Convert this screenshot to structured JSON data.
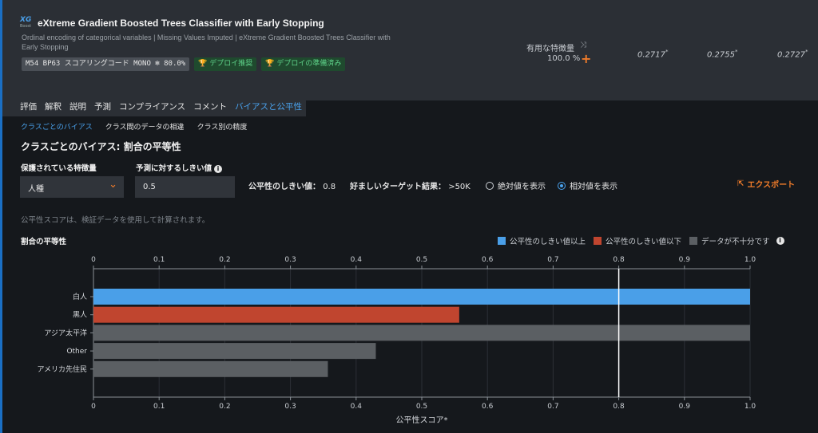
{
  "model": {
    "logo_text": "XG",
    "logo_sub": "Boost",
    "title": "eXtreme Gradient Boosted Trees Classifier with Early Stopping",
    "description": "Ordinal encoding of categorical variables | Missing Values Imputed | eXtreme Gradient Boosted Trees Classifier with Early Stopping",
    "badges": [
      {
        "label": "M54  BP63  スコアリングコード  MONO  ❄ 80.0%",
        "kind": "grey"
      },
      {
        "label": "🏆 デプロイ推奨",
        "kind": "green"
      },
      {
        "label": "🏆 デプロイの準備済み",
        "kind": "green"
      }
    ],
    "importance_label": "有用な特徴量",
    "importance_value": "100.0 %",
    "scores": [
      "0.2717",
      "0.2755",
      "0.2727"
    ],
    "score_mark": "*"
  },
  "tabs": [
    "評価",
    "解釈",
    "説明",
    "予測",
    "コンプライアンス",
    "コメント",
    "バイアスと公平性"
  ],
  "active_tab": 6,
  "subtabs": [
    "クラスごとのバイアス",
    "クラス間のデータの相違",
    "クラス別の精度"
  ],
  "active_subtab": 0,
  "section_title": "クラスごとのバイアス: 割合の平等性",
  "controls": {
    "protected_label": "保護されている特徴量",
    "protected_value": "人種",
    "threshold_label": "予測に対するしきい値",
    "threshold_value": "0.5",
    "fairness_threshold_label": "公平性のしきい値：",
    "fairness_threshold_value": "0.8",
    "favorable_label": "好ましいターゲット結果：",
    "favorable_value": ">50K",
    "radio_absolute": "絶対値を表示",
    "radio_relative": "相対値を表示",
    "radio_selected": "relative",
    "export_label": "エクスポート"
  },
  "note": "公平性スコアは、検証データを使用して計算されます。",
  "chart_heading": "割合の平等性",
  "legend": [
    {
      "label": "公平性のしきい値以上",
      "color": "#4a9fe8"
    },
    {
      "label": "公平性のしきい値以下",
      "color": "#c0452f"
    },
    {
      "label": "データが不十分です",
      "color": "#5b5f63"
    }
  ],
  "chart_data": {
    "type": "bar",
    "orientation": "horizontal",
    "categories": [
      "白人",
      "黒人",
      "アジア太平洋",
      "Other",
      "アメリカ先住民"
    ],
    "values": [
      1.0,
      0.557,
      1.0,
      0.43,
      0.357
    ],
    "status": [
      "above",
      "below",
      "insufficient",
      "insufficient",
      "insufficient"
    ],
    "colors": {
      "above": "#4a9fe8",
      "below": "#c0452f",
      "insufficient": "#5b5f63"
    },
    "xlim": [
      0,
      1.0
    ],
    "xticks": [
      "0",
      "0.1",
      "0.2",
      "0.3",
      "0.4",
      "0.5",
      "0.6",
      "0.7",
      "0.8",
      "0.9",
      "1.0"
    ],
    "threshold": 0.8,
    "xlabel": "公平性スコア*",
    "grid": true
  }
}
